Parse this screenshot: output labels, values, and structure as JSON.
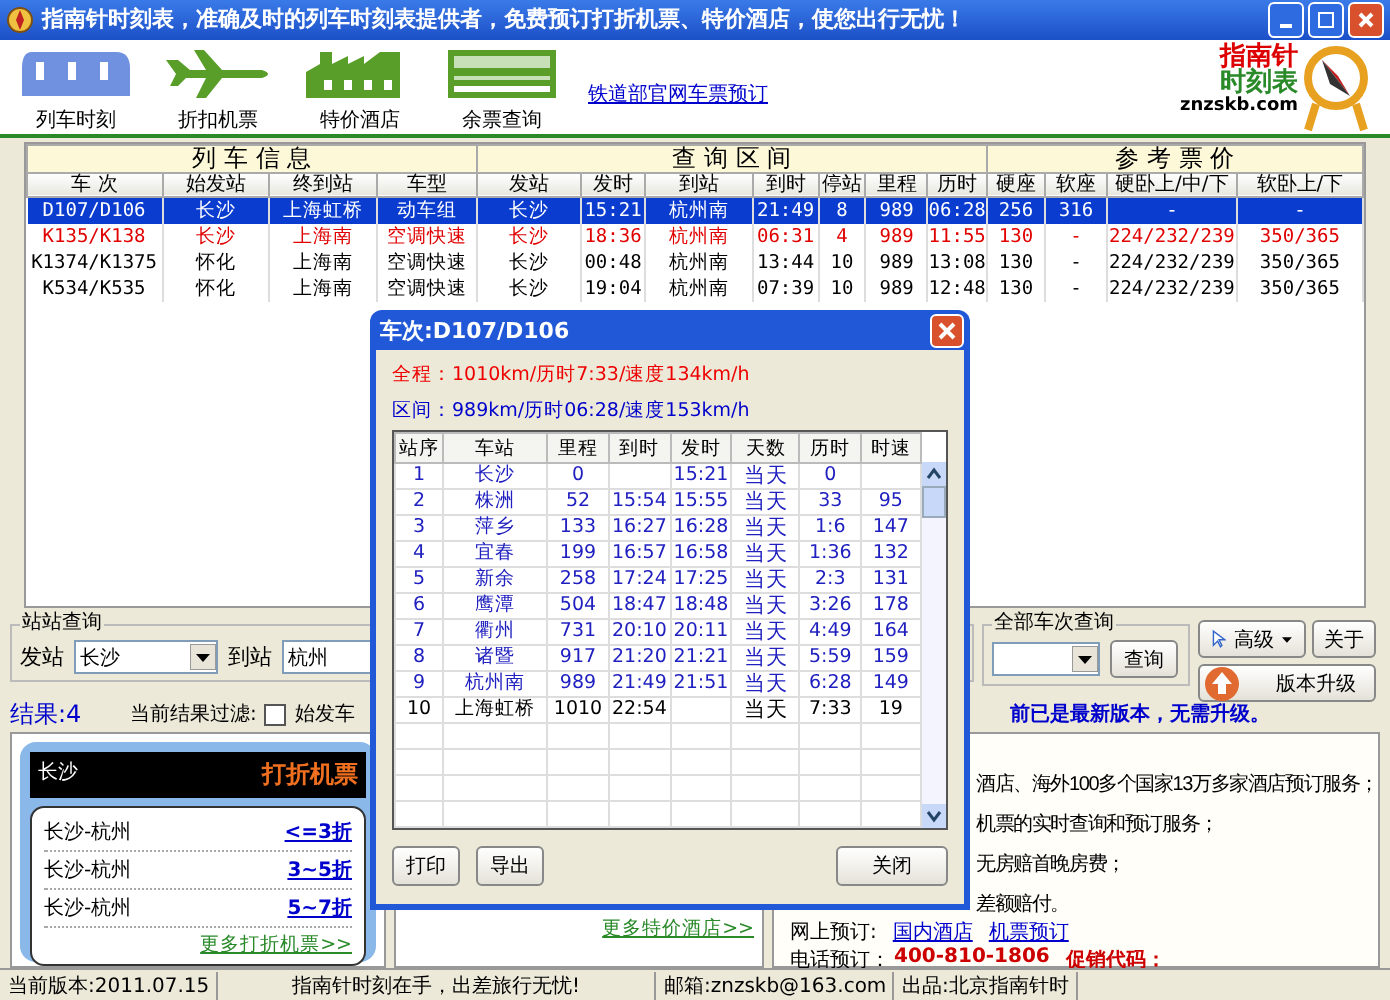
{
  "window": {
    "title": "指南针时刻表，准确及时的列车时刻表提供者，免费预订打折机票、特价酒店，使您出行无忧！"
  },
  "toolbar": [
    {
      "kind": "train",
      "label": "列车时刻"
    },
    {
      "kind": "plane",
      "label": "折扣机票"
    },
    {
      "kind": "hotel",
      "label": "特价酒店"
    },
    {
      "kind": "ticket",
      "label": "余票查询"
    }
  ],
  "toolbar_link": "铁道部官网车票预订",
  "logo": {
    "line_1": "指南针",
    "line_2": "时刻表",
    "domain": "znzskb.com"
  },
  "table": {
    "groups": [
      "列 车 信 息",
      "查 询 区 间",
      "参 考 票 价"
    ],
    "columns": [
      "车 次",
      "始发站",
      "终到站",
      "车型",
      "发站",
      "发时",
      "到站",
      "到时",
      "停站",
      "里程",
      "历时",
      "硬座",
      "软座",
      "硬卧上/中/下",
      "软卧上/下"
    ],
    "rows": [
      {
        "selected": true,
        "emphasized": false,
        "cells": [
          "D107/D106",
          "长沙",
          "上海虹桥",
          "动车组",
          "长沙",
          "15:21",
          "杭州南",
          "21:49",
          "8",
          "989",
          "06:28",
          "256",
          "316",
          "-",
          "-"
        ]
      },
      {
        "selected": false,
        "emphasized": true,
        "cells": [
          "K135/K138",
          "长沙",
          "上海南",
          "空调快速",
          "长沙",
          "18:36",
          "杭州南",
          "06:31",
          "4",
          "989",
          "11:55",
          "130",
          "-",
          "224/232/239",
          "350/365"
        ]
      },
      {
        "selected": false,
        "emphasized": false,
        "cells": [
          "K1374/K1375",
          "怀化",
          "上海南",
          "空调快速",
          "长沙",
          "00:48",
          "杭州南",
          "13:44",
          "10",
          "989",
          "13:08",
          "130",
          "-",
          "224/232/239",
          "350/365"
        ]
      },
      {
        "selected": false,
        "emphasized": false,
        "cells": [
          "K534/K535",
          "怀化",
          "上海南",
          "空调快速",
          "长沙",
          "19:04",
          "杭州南",
          "07:39",
          "10",
          "989",
          "12:48",
          "130",
          "-",
          "224/232/239",
          "350/365"
        ]
      }
    ]
  },
  "station_search": {
    "legend": "站站查询",
    "from_label": "发站",
    "from_value": "长沙",
    "to_label": "到站",
    "to_value": "杭州"
  },
  "train_search": {
    "legend": "全部车次查询",
    "button": "查询"
  },
  "buttons": {
    "advanced": "高级",
    "about": "关于",
    "upgrade": "版本升级"
  },
  "results": {
    "count": "结果:4",
    "filter_label": "当前结果过滤:",
    "filter_option": "始发车",
    "filter_checked": false,
    "version_note": "前已是最新版本，无需升级。"
  },
  "flight_ad": {
    "city": "长沙",
    "title": "打折机票",
    "rows": [
      {
        "route": "长沙-杭州",
        "discount": "<=3折"
      },
      {
        "route": "长沙-杭州",
        "discount": "3~5折"
      },
      {
        "route": "长沙-杭州",
        "discount": "5~7折"
      }
    ],
    "more": "更多打折机票>>"
  },
  "hotel_ad": {
    "more": "更多特价酒店>>"
  },
  "info_panel": {
    "lines": [
      "酒店、海外100多个国家13万多家酒店预订服务；",
      "机票的实时查询和预订服务；",
      "无房赔首晚房费；",
      "差额赔付。"
    ],
    "online_label": "网上预订:",
    "online_links": [
      "国内酒店",
      "机票预订"
    ],
    "phone_label": "电话预订：",
    "phone": "400-810-1806",
    "promo_label": "促销代码："
  },
  "dialog": {
    "title": "车次:D107/D106",
    "total": "全程：1010km/历时7:33/速度134km/h",
    "section": "区间：989km/历时06:28/速度153km/h",
    "columns": [
      "站序",
      "车站",
      "里程",
      "到时",
      "发时",
      "天数",
      "历时",
      "时速"
    ],
    "rows": [
      {
        "in_range": true,
        "cells": [
          "1",
          "长沙",
          "0",
          "",
          "15:21",
          "当天",
          "0",
          ""
        ]
      },
      {
        "in_range": true,
        "cells": [
          "2",
          "株洲",
          "52",
          "15:54",
          "15:55",
          "当天",
          "33",
          "95"
        ]
      },
      {
        "in_range": true,
        "cells": [
          "3",
          "萍乡",
          "133",
          "16:27",
          "16:28",
          "当天",
          "1:6",
          "147"
        ]
      },
      {
        "in_range": true,
        "cells": [
          "4",
          "宜春",
          "199",
          "16:57",
          "16:58",
          "当天",
          "1:36",
          "132"
        ]
      },
      {
        "in_range": true,
        "cells": [
          "5",
          "新余",
          "258",
          "17:24",
          "17:25",
          "当天",
          "2:3",
          "131"
        ]
      },
      {
        "in_range": true,
        "cells": [
          "6",
          "鹰潭",
          "504",
          "18:47",
          "18:48",
          "当天",
          "3:26",
          "178"
        ]
      },
      {
        "in_range": true,
        "cells": [
          "7",
          "衢州",
          "731",
          "20:10",
          "20:11",
          "当天",
          "4:49",
          "164"
        ]
      },
      {
        "in_range": true,
        "cells": [
          "8",
          "诸暨",
          "917",
          "21:20",
          "21:21",
          "当天",
          "5:59",
          "159"
        ]
      },
      {
        "in_range": true,
        "cells": [
          "9",
          "杭州南",
          "989",
          "21:49",
          "21:51",
          "当天",
          "6:28",
          "149"
        ]
      },
      {
        "in_range": false,
        "cells": [
          "10",
          "上海虹桥",
          "1010",
          "22:54",
          "",
          "当天",
          "7:33",
          "19"
        ]
      }
    ],
    "buttons": [
      "打印",
      "导出"
    ],
    "close": "关闭"
  },
  "status_bar": [
    "当前版本:2011.07.15",
    "指南针时刻在手，出差旅行无忧!",
    "邮箱:znzskb@163.com",
    "出品:北京指南针时"
  ]
}
